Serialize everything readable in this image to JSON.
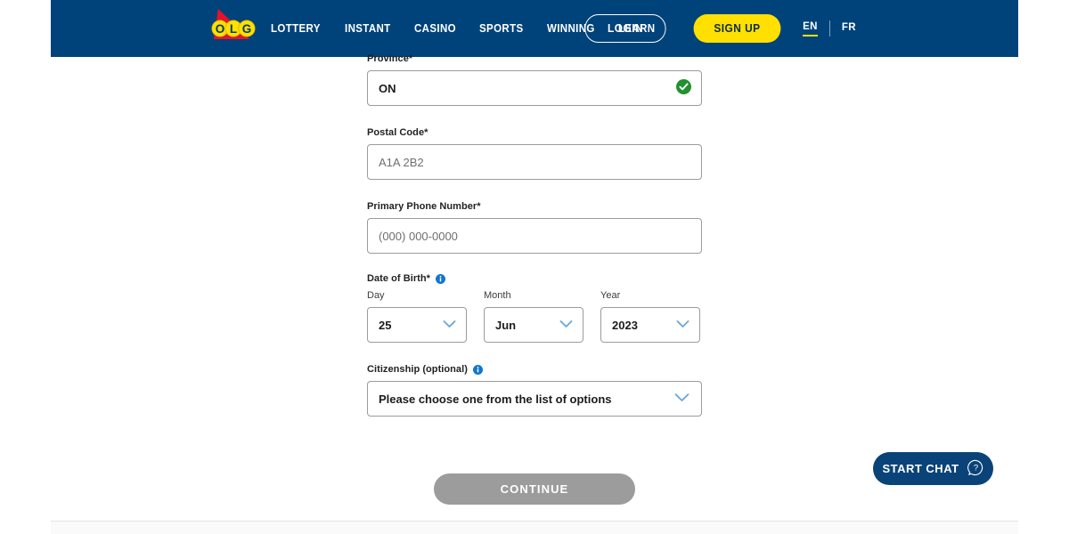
{
  "header": {
    "logo": {
      "name": "olg-logo",
      "letters": [
        "O",
        "L",
        "G"
      ],
      "shape_color": "#e6122c",
      "circle_color": "#ffe000",
      "letter_color": "#003b71"
    },
    "nav": [
      {
        "label": "LOTTERY"
      },
      {
        "label": "INSTANT"
      },
      {
        "label": "CASINO"
      },
      {
        "label": "SPORTS"
      },
      {
        "label": "WINNING"
      },
      {
        "label": "LEARN"
      }
    ],
    "login_label": "LOGIN",
    "signup_label": "SIGN UP",
    "languages": [
      {
        "code": "EN",
        "active": true
      },
      {
        "code": "FR",
        "active": false
      }
    ],
    "background_color": "#00437a",
    "accent_color": "#ffe000"
  },
  "form": {
    "province": {
      "label": "Province*",
      "value": "ON",
      "status_icon": "check-circle-icon",
      "status_color": "#22912f"
    },
    "postal_code": {
      "label": "Postal Code*",
      "value": "",
      "placeholder": "A1A 2B2"
    },
    "phone": {
      "label": "Primary Phone Number*",
      "value": "",
      "placeholder": "(000) 000-0000"
    },
    "date_of_birth": {
      "label": "Date of Birth*",
      "info_icon": "info-icon",
      "day": {
        "label": "Day",
        "value": "25"
      },
      "month": {
        "label": "Month",
        "value": "Jun"
      },
      "year": {
        "label": "Year",
        "value": "2023"
      }
    },
    "citizenship": {
      "label": "Citizenship (optional)",
      "info_icon": "info-icon",
      "value": "Please choose one from the list of options"
    }
  },
  "actions": {
    "continue_label": "CONTINUE",
    "continue_disabled": true,
    "continue_color": "#9c9c9c",
    "chat_label": "START CHAT",
    "chat_icon": "chat-question-icon",
    "chat_color": "#0a4377"
  }
}
